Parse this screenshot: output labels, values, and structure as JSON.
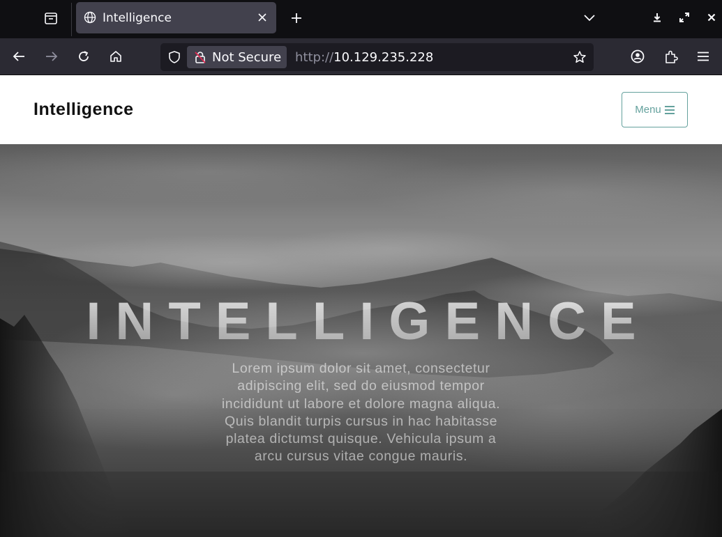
{
  "browser": {
    "tab": {
      "title": "Intelligence"
    },
    "url": {
      "security_label": "Not Secure",
      "protocol": "http://",
      "host": "10.129.235.228"
    },
    "icons": {
      "overview": "tab-overview-icon",
      "globe": "globe-icon",
      "close": "close-icon",
      "new_tab": "plus-icon",
      "tab_list": "chevron-down-icon",
      "back": "back-arrow-icon",
      "forward": "forward-arrow-icon",
      "reload": "reload-icon",
      "home": "home-icon",
      "shield": "shield-icon",
      "lock": "insecure-lock-icon",
      "bookmark": "star-icon",
      "account": "account-icon",
      "extensions": "extensions-icon",
      "menu": "hamburger-icon"
    }
  },
  "site": {
    "brand": "Intelligence",
    "menu_label": "Menu",
    "accent_color": "#64a19d"
  },
  "hero": {
    "title": "INTELLIGENCE",
    "text": "Lorem ipsum dolor sit amet, consectetur adipiscing elit, sed do eiusmod tempor incididunt ut labore et dolore magna aliqua. Quis blandit turpis cursus in hac habitasse platea dictumst quisque. Vehicula ipsum a arcu cursus vitae congue mauris."
  }
}
